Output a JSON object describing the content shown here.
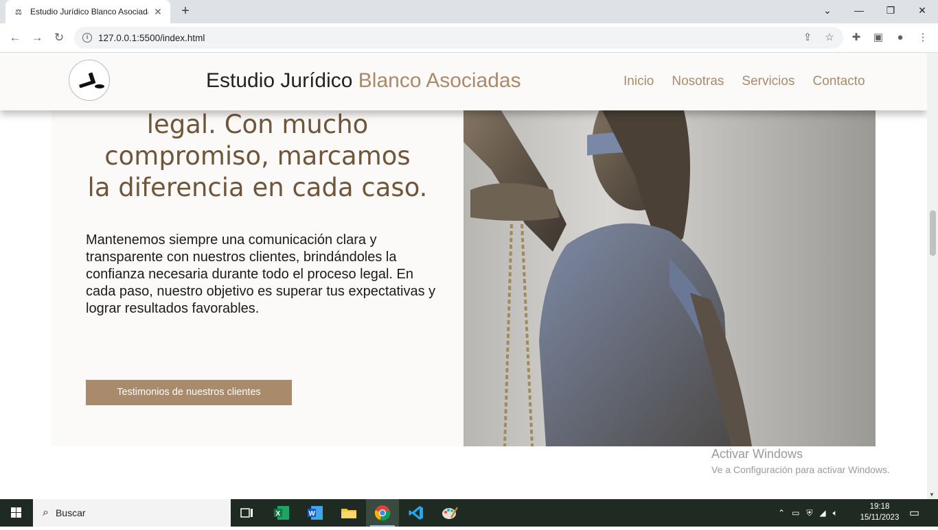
{
  "browser": {
    "tab_title": "Estudio Jurídico Blanco Asociada",
    "tab_close": "✕",
    "new_tab": "+",
    "url": "127.0.0.1:5500/index.html"
  },
  "site": {
    "brand_main": "Estudio Jurídico ",
    "brand_accent": "Blanco Asociadas",
    "nav": [
      "Inicio",
      "Nosotras",
      "Servicios",
      "Contacto"
    ]
  },
  "hero": {
    "heading_lines": [
      "legal. Con mucho",
      "compromiso, marcamos",
      "la diferencia en cada caso."
    ],
    "paragraph": "Mantenemos siempre una comunicación clara y transparente con nuestros clientes, brindándoles la confianza necesaria durante todo el proceso legal. En cada paso, nuestro objetivo es superar tus expectativas y lograr resultados favorables.",
    "button": "Testimonios de nuestros clientes"
  },
  "watermark": {
    "line1": "Activar Windows",
    "line2": "Ve a Configuración para activar Windows."
  },
  "taskbar": {
    "search": "Buscar",
    "time": "19:18",
    "date": "15/11/2023",
    "apps": [
      "task-view-icon",
      "excel-icon",
      "word-icon",
      "file-explorer-icon",
      "chrome-icon",
      "vscode-icon",
      "paint-icon"
    ]
  },
  "colors": {
    "accent": "#a98a6a",
    "heading": "#6f5539",
    "header_bg": "#fcfaf8"
  }
}
